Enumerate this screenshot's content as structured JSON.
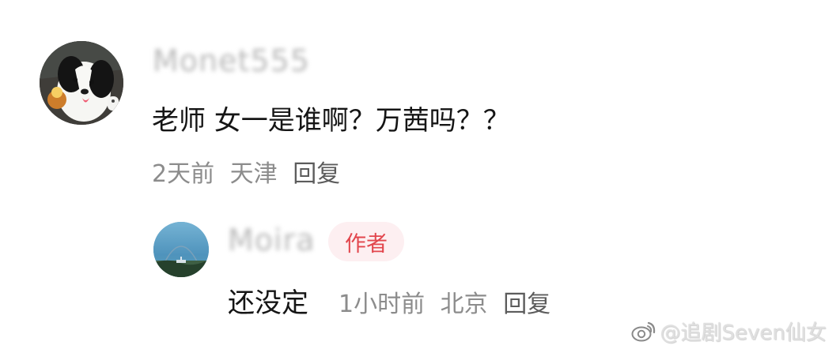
{
  "comment": {
    "username": "Monet555",
    "text": "老师 女一是谁啊？万茜吗？？",
    "time": "2天前",
    "location": "天津",
    "reply_label": "回复"
  },
  "reply": {
    "username": "Moira",
    "badge": "作者",
    "text": "还没定",
    "time": "1小时前",
    "location": "北京",
    "reply_label": "回复"
  },
  "watermark": {
    "text": "@追剧Seven仙女",
    "icon": "weibo-icon"
  }
}
